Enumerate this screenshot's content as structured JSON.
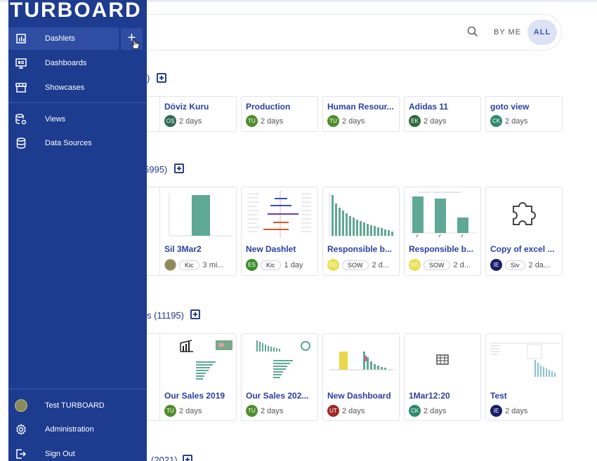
{
  "sidebar": {
    "logo": "TURBOARD",
    "items": [
      {
        "label": "Dashlets",
        "icon": "chart-icon"
      },
      {
        "label": "Dashboards",
        "icon": "monitor-icon"
      },
      {
        "label": "Showcases",
        "icon": "store-icon"
      },
      {
        "label": "Views",
        "icon": "database-gear-icon"
      },
      {
        "label": "Data Sources",
        "icon": "database-icon"
      }
    ],
    "add_label": "+",
    "footer": [
      {
        "label": "Test TURBOARD",
        "icon": "avatar"
      },
      {
        "label": "Administration",
        "icon": "gear-icon"
      },
      {
        "label": "Sign Out",
        "icon": "sign-out-icon"
      }
    ]
  },
  "search": {
    "by_me": "BY ME",
    "all": "ALL"
  },
  "sections": [
    {
      "label": ")",
      "top": 0
    },
    {
      "label": "5995)"
    },
    {
      "label": "s (11195)",
      "count": "(11195)"
    },
    {
      "label": "(2021)"
    }
  ],
  "row1": [
    {
      "title": "Döviz Kuru",
      "initials": "OŞ",
      "color": "#2e6b55",
      "time": "2 days"
    },
    {
      "title": "Production",
      "initials": "TU",
      "color": "#4e8e2c",
      "time": "2 days"
    },
    {
      "title": "Human Resour...",
      "initials": "TU",
      "color": "#4e8e2c",
      "time": "2 days"
    },
    {
      "title": "Adidas 11",
      "initials": "EK",
      "color": "#2e6b3d",
      "time": "2 days"
    },
    {
      "title": "goto view",
      "initials": "CK",
      "color": "#2e8a6b",
      "time": "2 days"
    }
  ],
  "row2": [
    {
      "title": "Sil 3Mar2",
      "tag": "Kic",
      "time": "3 mi...",
      "initials": "",
      "color": "#8a8a5a"
    },
    {
      "title": "New Dashlet",
      "tag": "Kic",
      "time": "1 day",
      "initials": "ES",
      "color": "#3e8e2c"
    },
    {
      "title": "Responsible b...",
      "tag": "SOW",
      "time": "2 d...",
      "initials": "EG",
      "color": "#e8e050"
    },
    {
      "title": "Responsible b...",
      "tag": "SOW",
      "time": "2 d...",
      "initials": "EG",
      "color": "#e8e050"
    },
    {
      "title": "Copy of excel ...",
      "tag": "Siv",
      "time": "2 da...",
      "initials": "IE",
      "color": "#1a1f6b"
    }
  ],
  "row3": [
    {
      "title": "Our Sales 2019",
      "initials": "TU",
      "color": "#4e8e2c",
      "time": "2 days"
    },
    {
      "title": "Our Sales 202...",
      "initials": "TU",
      "color": "#4e8e2c",
      "time": "2 days"
    },
    {
      "title": "New Dashboard",
      "initials": "UT",
      "color": "#a02a2a",
      "time": "2 days"
    },
    {
      "title": "1Mar12:20",
      "initials": "CK",
      "color": "#2e8a6b",
      "time": "2 days"
    },
    {
      "title": "Test",
      "initials": "IE",
      "color": "#1a1f6b",
      "time": "2 days"
    }
  ]
}
